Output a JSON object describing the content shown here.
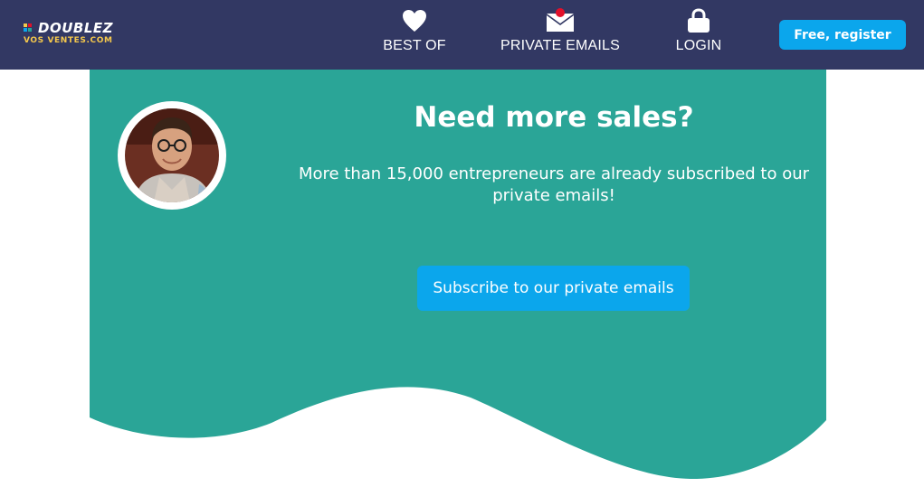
{
  "header": {
    "logo": {
      "line1": "DOUBLEZ",
      "line2": "VOS VENTES.COM"
    },
    "nav": [
      {
        "label": "BEST OF",
        "icon": "heart-icon"
      },
      {
        "label": "PRIVATE EMAILS",
        "icon": "envelope-icon",
        "has_notification_dot": true
      },
      {
        "label": "LOGIN",
        "icon": "lock-icon"
      }
    ],
    "register_label": "Free, register"
  },
  "promo": {
    "title": "Need more sales?",
    "text": "More than 15,000 entrepreneurs are already subscribed to our private emails!",
    "cta_label": "Subscribe to our private emails",
    "avatar": "author-photo"
  },
  "colors": {
    "header_bg": "#323863",
    "accent_blue": "#0ba6ec",
    "teal": "#2aa597",
    "logo_yellow": "#f5c84c",
    "notification_red": "#e3102a",
    "text_white": "#ffffff"
  }
}
